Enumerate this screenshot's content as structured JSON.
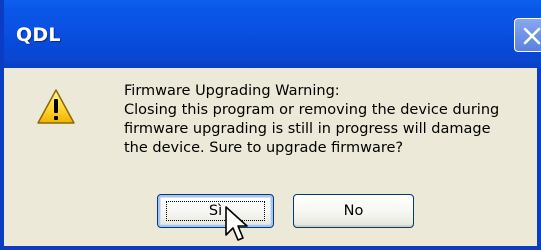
{
  "window": {
    "title": "QDL",
    "close_icon": "close-icon",
    "accent_color": "#0a57e6"
  },
  "dialog": {
    "icon": "warning-icon",
    "message_lines": [
      "Firmware Upgrading Warning:",
      "Closing this program or removing the device during",
      "firmware upgrading is still in progress will damage",
      "the device. Sure to upgrade firmware?"
    ]
  },
  "buttons": {
    "yes_label": "Sì",
    "no_label": "No"
  },
  "cursor": {
    "icon": "arrow-cursor-icon"
  }
}
